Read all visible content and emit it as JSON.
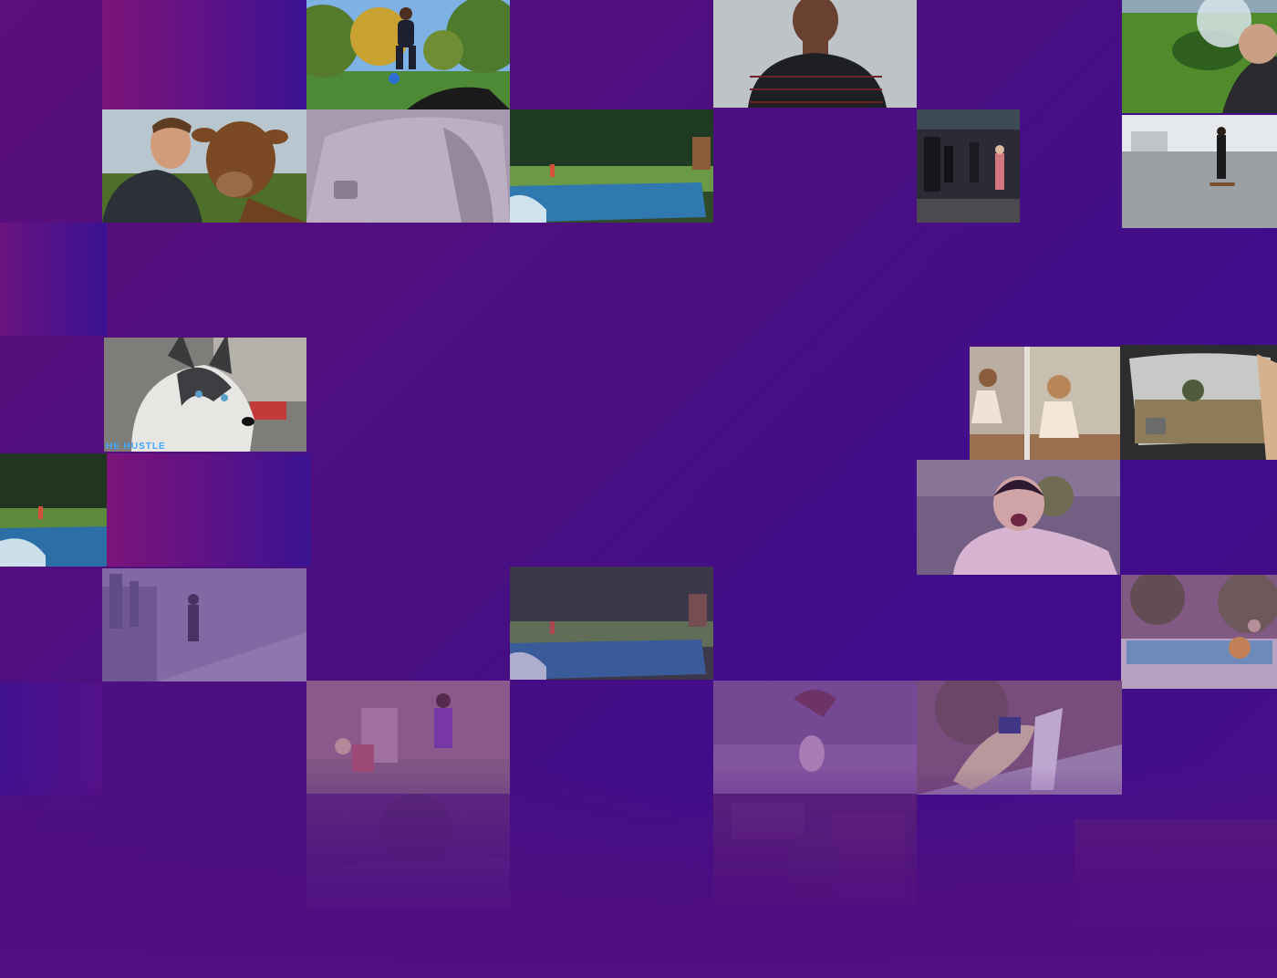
{
  "page": {
    "background_colors": [
      "#5a0f7a",
      "#4a0f82",
      "#3f0d8c"
    ],
    "overlay_color": "#4f0e80"
  },
  "tiles": [
    {
      "id": "gradient-top-left",
      "kind": "gradient"
    },
    {
      "id": "man-basketball-park",
      "kind": "photo",
      "scene": "park-basketball"
    },
    {
      "id": "man-talking-portrait",
      "kind": "photo",
      "scene": "talking-man"
    },
    {
      "id": "man-giant-ball-lawn",
      "kind": "photo",
      "scene": "lawn-ball"
    },
    {
      "id": "man-with-cow",
      "kind": "photo",
      "scene": "man-cow"
    },
    {
      "id": "car-interior-faded",
      "kind": "photo",
      "scene": "car-faded"
    },
    {
      "id": "pool-backyard-top",
      "kind": "photo",
      "scene": "pool"
    },
    {
      "id": "crowd-street-dark",
      "kind": "photo",
      "scene": "crowd"
    },
    {
      "id": "skateboarder-street",
      "kind": "photo",
      "scene": "skateboard"
    },
    {
      "id": "gradient-left-1",
      "kind": "gradient"
    },
    {
      "id": "husky-dog",
      "kind": "photo",
      "scene": "husky",
      "badge": "HE HUSTLE"
    },
    {
      "id": "two-girls-mirror",
      "kind": "photo",
      "scene": "girls"
    },
    {
      "id": "car-window-field",
      "kind": "photo",
      "scene": "car-window"
    },
    {
      "id": "pool-backyard-left",
      "kind": "photo",
      "scene": "pool"
    },
    {
      "id": "gradient-left-2",
      "kind": "gradient"
    },
    {
      "id": "toddler-excited",
      "kind": "photo",
      "scene": "toddler"
    },
    {
      "id": "hoverboard-rooftop",
      "kind": "photo",
      "scene": "rooftop"
    },
    {
      "id": "pool-backyard-middle",
      "kind": "photo",
      "scene": "pool"
    },
    {
      "id": "kid-above-ground-pool",
      "kind": "photo",
      "scene": "kid-pool"
    },
    {
      "id": "gradient-left-3",
      "kind": "gradient"
    },
    {
      "id": "people-dancing-patio",
      "kind": "photo",
      "scene": "dancing"
    },
    {
      "id": "girl-jumping-faded",
      "kind": "photo",
      "scene": "jump"
    },
    {
      "id": "person-falling-slide",
      "kind": "photo",
      "scene": "slide"
    },
    {
      "id": "backyard-trampoline-faded",
      "kind": "photo",
      "scene": "yard-faded"
    },
    {
      "id": "kitchen-faded",
      "kind": "photo",
      "scene": "kitchen-faded"
    },
    {
      "id": "blurred-faded-right",
      "kind": "photo",
      "scene": "blur-faded"
    }
  ]
}
